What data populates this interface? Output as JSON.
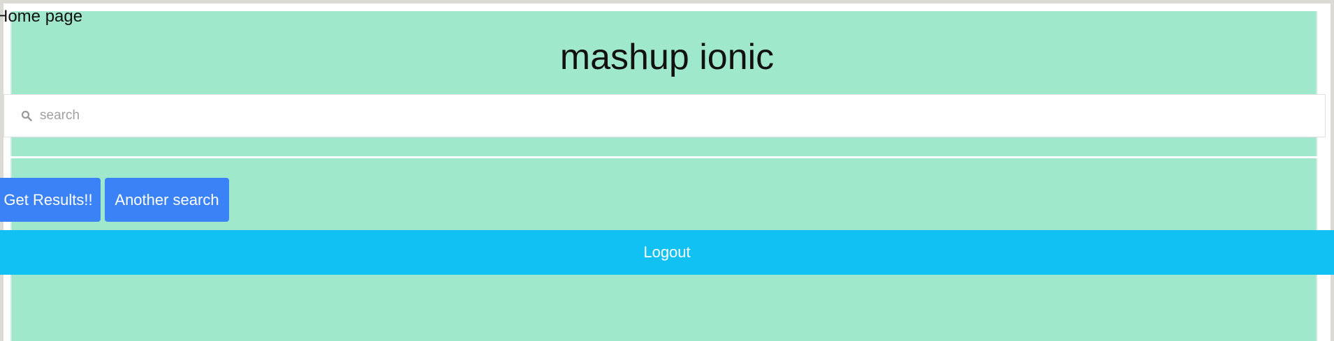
{
  "page": {
    "label": "Home page"
  },
  "header": {
    "title": "mashup ionic"
  },
  "search": {
    "placeholder": "search",
    "value": "",
    "icon": "search-icon"
  },
  "actions": {
    "get_results_label": "Get Results!!",
    "another_search_label": "Another search",
    "logout_label": "Logout"
  },
  "colors": {
    "background": "#a0e8cc",
    "primary_button": "#3b82f6",
    "logout_bar": "#12c1f3"
  }
}
